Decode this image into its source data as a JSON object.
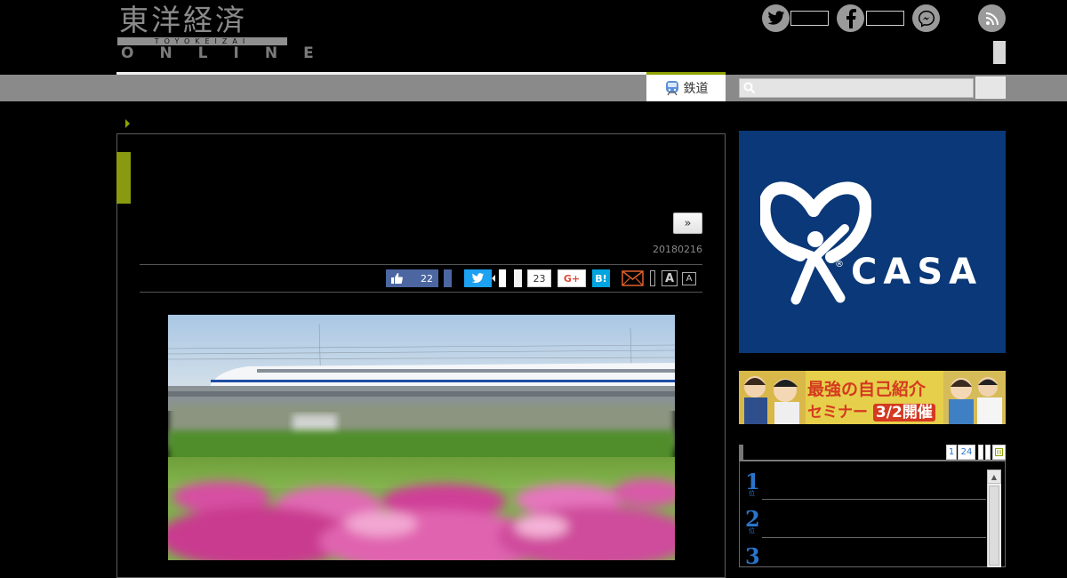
{
  "header": {
    "logo_kanji": "東洋経済",
    "logo_roman": "TOYOKEIZAI",
    "logo_online": "ONLINE",
    "social": [
      "twitter-icon",
      "facebook-icon",
      "messenger-icon",
      "rss-icon"
    ]
  },
  "nav": {
    "tab_label": "鉄道",
    "search": {
      "placeholder": ""
    }
  },
  "article": {
    "next_label": "»",
    "date": "20180216",
    "share": {
      "like_count": "22",
      "google_count": "23",
      "gplus_label": "G+",
      "hatena_label": "B!",
      "font_big_label": "A",
      "font_small_label": "A"
    }
  },
  "sidebar": {
    "ad_casa_label": "CASA",
    "ad_casa_reg": "®",
    "ad_seminar_line1": "最強の自己紹介",
    "ad_seminar_line2": "セミナー",
    "ad_seminar_date": "3/2開催",
    "ranking": {
      "tabs": [
        "1",
        "24"
      ],
      "ranks": [
        "1",
        "2",
        "3"
      ],
      "rank_suffix": "位"
    }
  },
  "colors": {
    "accent_green": "#8fa300",
    "nav_gray": "#8a8a8a",
    "casa_blue": "#0a3878",
    "rank_blue": "#2a74c9"
  }
}
